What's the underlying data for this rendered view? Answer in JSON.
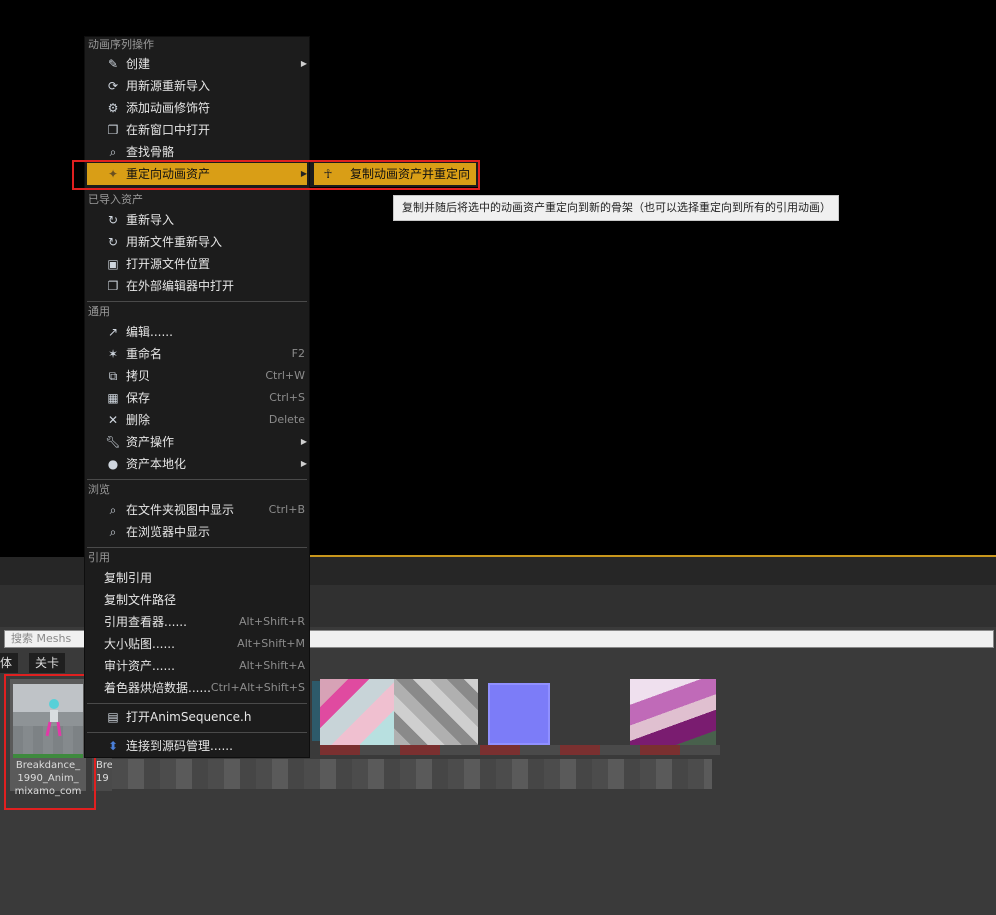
{
  "context_menu": {
    "sections": {
      "anim_ops": "动画序列操作",
      "imported": "已导入资产",
      "common": "通用",
      "browse": "浏览",
      "references": "引用"
    },
    "anim_items": [
      {
        "label": "创建",
        "icon": "create-icon",
        "has_submenu": true
      },
      {
        "label": "用新源重新导入",
        "icon": "reimport-new-source-icon"
      },
      {
        "label": "添加动画修饰符",
        "icon": "anim-modifier-icon"
      },
      {
        "label": "在新窗口中打开",
        "icon": "open-window-icon"
      },
      {
        "label": "查找骨骼",
        "icon": "find-skeleton-icon"
      },
      {
        "label": "重定向动画资产",
        "icon": "retarget-icon",
        "has_submenu": true,
        "active": true
      }
    ],
    "imported_items": [
      {
        "label": "重新导入",
        "icon": "reimport-icon"
      },
      {
        "label": "用新文件重新导入",
        "icon": "reimport-file-icon"
      },
      {
        "label": "打开源文件位置",
        "icon": "folder-source-icon"
      },
      {
        "label": "在外部编辑器中打开",
        "icon": "external-editor-icon"
      }
    ],
    "common_items": [
      {
        "label": "编辑......",
        "icon": "edit-icon",
        "shortcut": ""
      },
      {
        "label": "重命名",
        "icon": "rename-icon",
        "shortcut": "F2"
      },
      {
        "label": "拷贝",
        "icon": "copy-icon",
        "shortcut": "Ctrl+W"
      },
      {
        "label": "保存",
        "icon": "save-icon",
        "shortcut": "Ctrl+S"
      },
      {
        "label": "删除",
        "icon": "delete-icon",
        "shortcut": "Delete"
      },
      {
        "label": "资产操作",
        "icon": "wrench-icon",
        "has_submenu": true
      },
      {
        "label": "资产本地化",
        "icon": "globe-icon",
        "has_submenu": true
      }
    ],
    "browse_items": [
      {
        "label": "在文件夹视图中显示",
        "icon": "magnifier-icon",
        "shortcut": "Ctrl+B"
      },
      {
        "label": "在浏览器中显示",
        "icon": "magnifier-icon",
        "shortcut": ""
      }
    ],
    "reference_items": [
      {
        "label": "复制引用",
        "shortcut": ""
      },
      {
        "label": "复制文件路径",
        "shortcut": ""
      },
      {
        "label": "引用查看器......",
        "shortcut": "Alt+Shift+R"
      },
      {
        "label": "大小贴图......",
        "shortcut": "Alt+Shift+M"
      },
      {
        "label": "审计资产......",
        "shortcut": "Alt+Shift+A"
      },
      {
        "label": "着色器烘焙数据......",
        "shortcut": "Ctrl+Alt+Shift+S"
      }
    ],
    "open_source_file": "打开AnimSequence.h",
    "source_control": "连接到源码管理......"
  },
  "submenu": {
    "label": "复制动画资产并重定向",
    "icon": "retarget-figure-icon"
  },
  "tooltip": "复制并随后将选中的动画资产重定向到新的骨架（也可以选择重定向到所有的引用动画）",
  "search": {
    "placeholder": "搜索 Meshs"
  },
  "filters": [
    "体",
    "关卡"
  ],
  "asset": {
    "name_lines": [
      "Breakdance_",
      "1990_Anim_",
      "mixamo_com"
    ],
    "partial_name_lines": [
      "Bre",
      "19"
    ]
  },
  "colors": {
    "menu_bg": "#1c1c1c",
    "highlight": "#d99e16",
    "annotation": "#e02020",
    "tooltip_bg": "#f0f0f0",
    "viewport_edge": "#c8961c"
  }
}
